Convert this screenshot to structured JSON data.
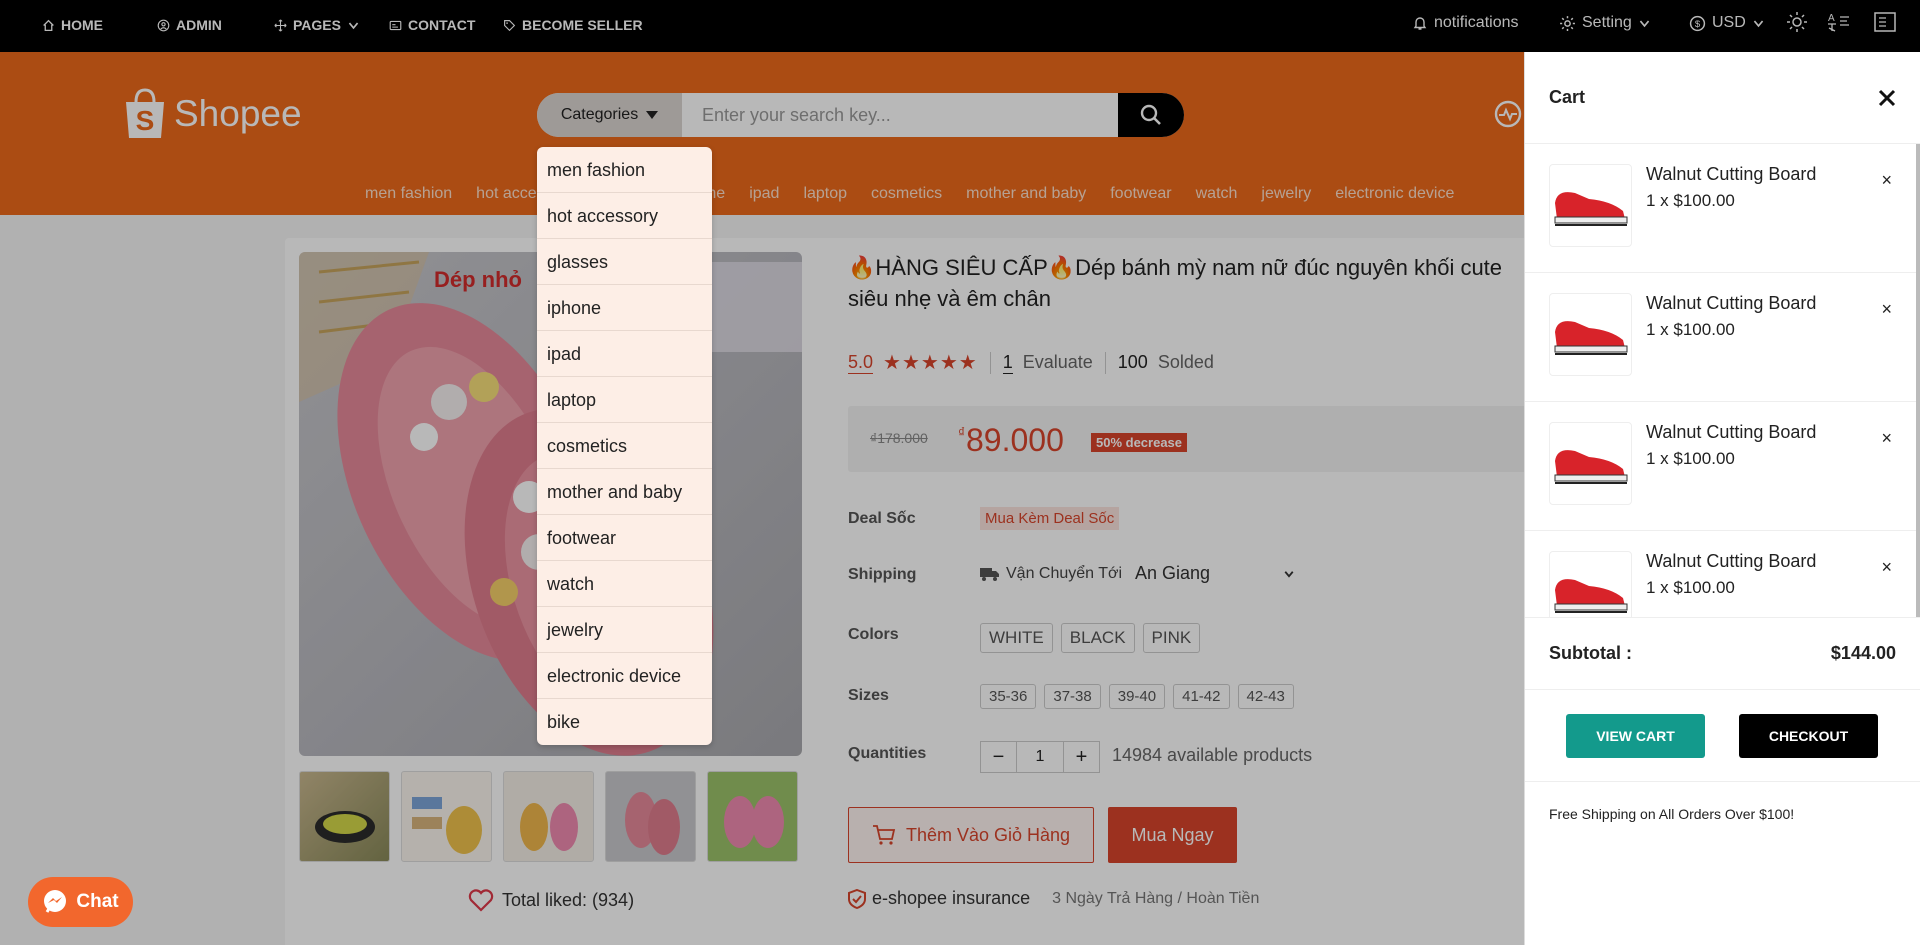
{
  "topbar": {
    "home": "HOME",
    "admin": "ADMIN",
    "pages": "PAGES",
    "contact": "CONTACT",
    "become_seller": "BECOME SELLER",
    "notifications": "notifications",
    "setting": "Setting",
    "currency": "USD"
  },
  "header": {
    "logo_text": "Shopee",
    "category_button": "Categories",
    "search_placeholder": "Enter your search key...",
    "links": [
      "men fashion",
      "hot accessory",
      "glasses",
      "iphone",
      "ipad",
      "laptop",
      "cosmetics",
      "mother and baby",
      "footwear",
      "watch",
      "jewelry",
      "electronic device"
    ]
  },
  "dropdown": {
    "items": [
      "men fashion",
      "hot accessory",
      "glasses",
      "iphone",
      "ipad",
      "laptop",
      "cosmetics",
      "mother and baby",
      "footwear",
      "watch",
      "jewelry",
      "electronic device",
      "bike"
    ]
  },
  "product": {
    "title": "🔥HÀNG SIÊU CẤP🔥Dép bánh mỳ nam nữ đúc nguyên khối cute siêu nhẹ và êm chân",
    "rating": "5.0",
    "stars": 5,
    "evaluate_count": "1",
    "evaluate_label": "Evaluate",
    "sold_count": "100",
    "sold_label": "Solded",
    "old_price": "178.000",
    "currency_symbol": "₫",
    "price": "89.000",
    "discount": "50% decrease",
    "deal_label": "Deal Sốc",
    "deal_value": "Mua Kèm Deal Sốc",
    "shipping_label": "Shipping",
    "shipping_text": "Vận Chuyển Tới",
    "shipping_location": "An Giang",
    "colors_label": "Colors",
    "colors": [
      "WHITE",
      "BLACK",
      "PINK"
    ],
    "sizes_label": "Sizes",
    "sizes": [
      "35-36",
      "37-38",
      "39-40",
      "41-42",
      "42-43"
    ],
    "quantities_label": "Quantities",
    "quantity": "1",
    "available": "14984 available products",
    "add_to_cart": "Thêm Vào Giỏ Hàng",
    "buy_now": "Mua Ngay",
    "liked": "Total liked: (934)",
    "insurance": "e-shopee insurance",
    "return_policy": "3 Ngày Trả Hàng / Hoàn Tiền",
    "image_text": "Dép nhỏ"
  },
  "cart": {
    "title": "Cart",
    "items": [
      {
        "name": "Walnut Cutting Board",
        "qty": "1 x $100.00"
      },
      {
        "name": "Walnut Cutting Board",
        "qty": "1 x $100.00"
      },
      {
        "name": "Walnut Cutting Board",
        "qty": "1 x $100.00"
      },
      {
        "name": "Walnut Cutting Board",
        "qty": "1 x $100.00"
      }
    ],
    "subtotal_label": "Subtotal :",
    "subtotal_value": "$144.00",
    "view_cart": "VIEW CART",
    "checkout": "CHECKOUT",
    "free_shipping": "Free Shipping on All Orders Over $100!"
  },
  "chat": {
    "label": "Chat"
  },
  "colors": {
    "brand": "#ee6a1b",
    "accent": "#d9452b",
    "teal": "#139a8c"
  }
}
